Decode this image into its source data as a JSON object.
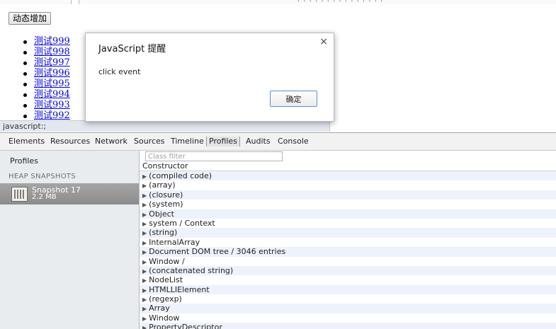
{
  "page": {
    "button_label": "动态增加",
    "items": [
      "测试999",
      "测试998",
      "测试997",
      "测试996",
      "测试995",
      "测试994",
      "测试993",
      "测试992"
    ]
  },
  "status_bar": {
    "text": "javascript:;"
  },
  "alert": {
    "title": "JavaScript 提醒",
    "message": "click event",
    "ok_label": "确定",
    "close_glyph": "×"
  },
  "devtools": {
    "tabs": [
      "Elements",
      "Resources",
      "Network",
      "Sources",
      "Timeline",
      "Profiles",
      "Audits",
      "Console"
    ],
    "active_tab": "Profiles",
    "sidebar": {
      "title": "Profiles",
      "section_header": "HEAP SNAPSHOTS",
      "snapshot_name": "Snapshot 17",
      "snapshot_size": "2.2 MB"
    },
    "filter_placeholder": "Class filter",
    "column_header": "Constructor",
    "rows": [
      "(compiled code)",
      "(array)",
      "(closure)",
      "(system)",
      "Object",
      "system / Context",
      "(string)",
      "InternalArray",
      "Document DOM tree / 3046 entries",
      "Window /",
      "(concatenated string)",
      "NodeList",
      "HTMLLIElement",
      "(regexp)",
      "Array",
      "Window",
      "PropertyDescriptor"
    ]
  }
}
